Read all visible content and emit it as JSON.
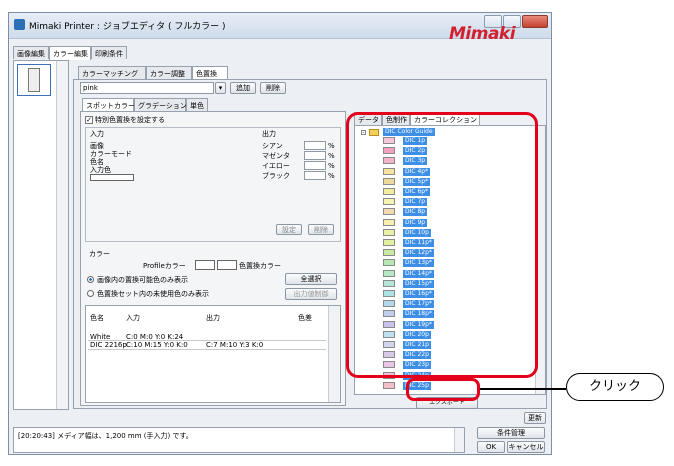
{
  "window": {
    "title": "Mimaki Printer : ジョブエディタ ( フルカラー )",
    "logo": "Mimaki"
  },
  "top_tabs": [
    "画像編集",
    "カラー編集",
    "印刷条件"
  ],
  "sub_tabs": [
    "カラーマッチング",
    "カラー調整",
    "色置換"
  ],
  "color_set": {
    "value": "pink",
    "add": "追加",
    "delete": "削除"
  },
  "inner_tabs": [
    "スポットカラー",
    "グラデーション",
    "単色"
  ],
  "spot": {
    "checkbox": "特別色置換を設定する",
    "input_title": "入力",
    "input_rows": [
      "画像",
      "カラーモード",
      "色名",
      "入力色"
    ],
    "output_title": "出力",
    "output_rows": [
      "シアン",
      "マゼンタ",
      "イエロー",
      "ブラック"
    ],
    "percent": "%",
    "set": "設定",
    "delete": "削除"
  },
  "color_section": {
    "title": "カラー",
    "profile_label": "Profileカラー",
    "replace_label": "色置換カラー",
    "radio1": "画像内の置換可能色のみ表示",
    "radio2": "色置換セット内の未使用色のみ表示",
    "select_all": "全選択",
    "output_value": "出力値制御"
  },
  "table": {
    "headers": [
      "色名",
      "入力",
      "出力",
      "色差"
    ],
    "rows": [
      [
        "White",
        "C:0 M:0 Y:0 K:24",
        "",
        ""
      ],
      [
        "DIC 2216p",
        "C:10 M:15 Y:0 K:0",
        "C:7 M:10 Y:3 K:0",
        ""
      ]
    ]
  },
  "right_tabs": [
    "データ",
    "色制作",
    "カラーコレクション"
  ],
  "color_collection": {
    "root": "DIC Color Guide",
    "items": [
      "DIC 1p",
      "DIC 2p",
      "DIC 3p",
      "DIC 4p*",
      "DIC 5p*",
      "DIC 6p*",
      "DIC 7p",
      "DIC 8p",
      "DIC 9p",
      "DIC 10p",
      "DIC 11p*",
      "DIC 12p*",
      "DIC 13p*",
      "DIC 14p*",
      "DIC 15p*",
      "DIC 16p*",
      "DIC 17p*",
      "DIC 18p*",
      "DIC 19p*",
      "DIC 20p",
      "DIC 21p",
      "DIC 22p",
      "DIC 23p",
      "DIC 24p",
      "DIC 25p"
    ],
    "swatch_colors": [
      "#f7c6d8",
      "#f2a0c0",
      "#f3b3c8",
      "#f5e3a0",
      "#efd99a",
      "#f3ec9e",
      "#f6f3b2",
      "#f3d8b0",
      "#f7eeb0",
      "#e9f0a8",
      "#dff0a0",
      "#c8e8a6",
      "#b5e6b3",
      "#b6e8c6",
      "#b3e6d6",
      "#aee3e3",
      "#b3d9ea",
      "#c0cfee",
      "#c8c2ec",
      "#bfe1f1",
      "#d3d6ea",
      "#d8c9e8",
      "#e8c6e8",
      "#f0bfd8",
      "#f3c0c9"
    ],
    "export": "エクスポート"
  },
  "update_button": "更新",
  "status_message": "[20:20:43] メディア幅は、1,200 mm (手入力) です。",
  "buttons": {
    "condition": "条件管理",
    "ok": "OK",
    "cancel": "キャンセル"
  },
  "callout": "クリック",
  "colors": {
    "highlight": "#3d8ee6",
    "annotation": "#e4001b"
  }
}
